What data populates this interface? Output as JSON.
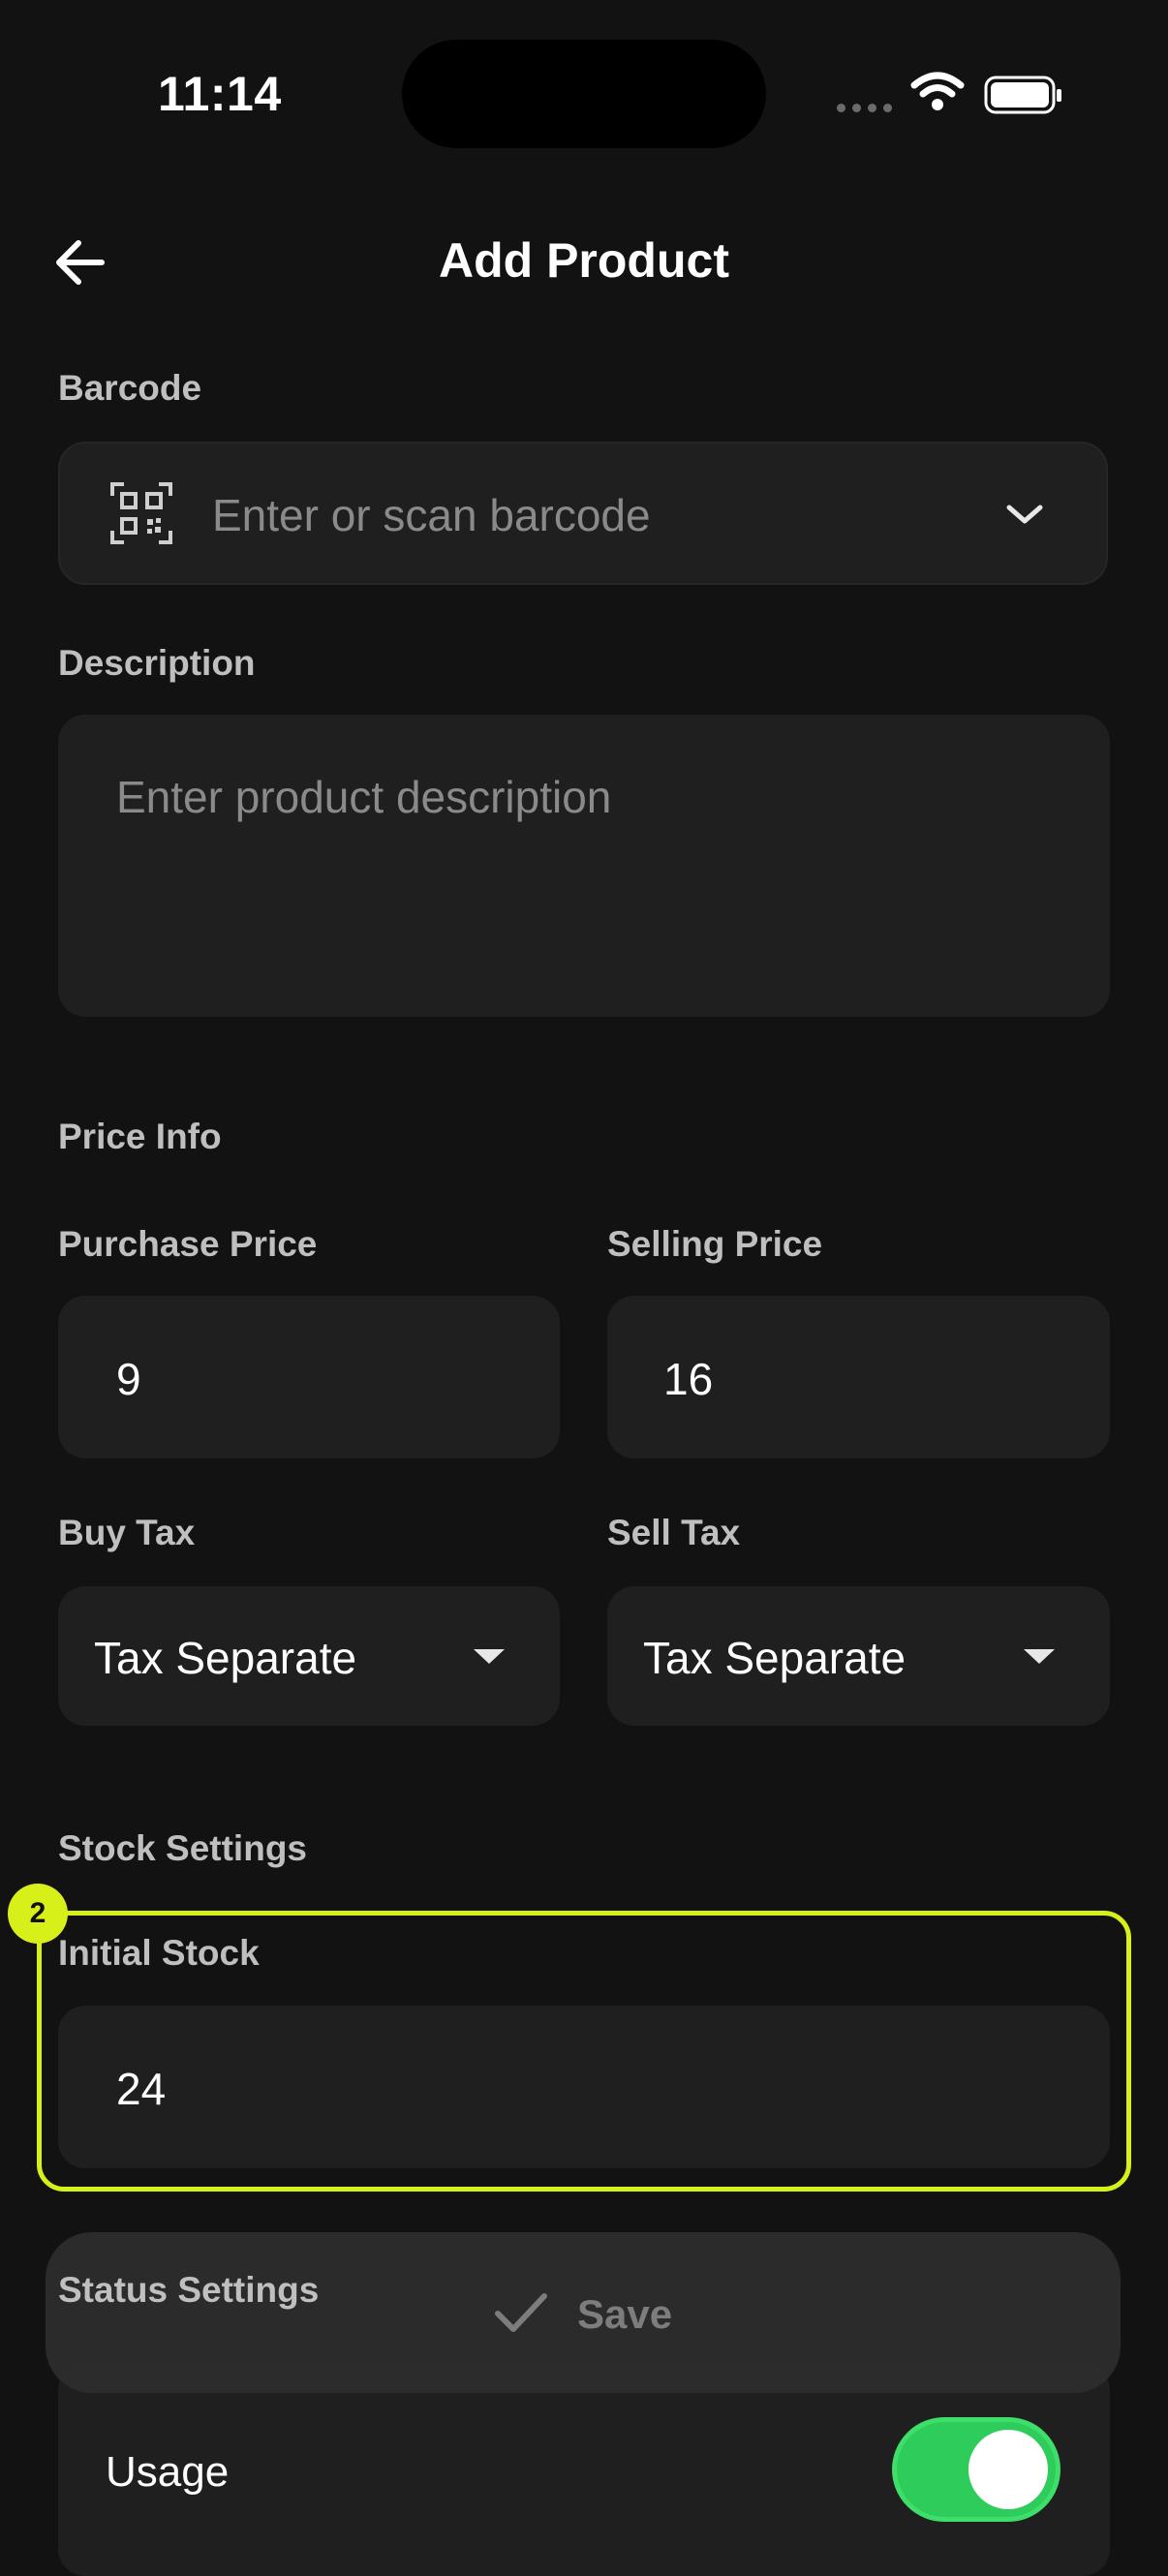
{
  "status_bar": {
    "time": "11:14"
  },
  "header": {
    "title": "Add Product"
  },
  "barcode": {
    "label": "Barcode",
    "placeholder": "Enter or scan barcode"
  },
  "description": {
    "label": "Description",
    "placeholder": "Enter product description"
  },
  "price_info": {
    "section_title": "Price Info",
    "purchase_price": {
      "label": "Purchase Price",
      "value": "9"
    },
    "selling_price": {
      "label": "Selling Price",
      "value": "16"
    },
    "buy_tax": {
      "label": "Buy Tax",
      "selected": "Tax Separate"
    },
    "sell_tax": {
      "label": "Sell Tax",
      "selected": "Tax Separate"
    }
  },
  "stock_settings": {
    "section_title": "Stock Settings",
    "initial_stock": {
      "label": "Initial Stock",
      "value": "24"
    },
    "highlight_badge": "2"
  },
  "status_settings": {
    "section_title": "Status Settings",
    "usage": {
      "label": "Usage",
      "enabled": true
    }
  },
  "save_button": {
    "label": "Save"
  },
  "colors": {
    "background": "#121212",
    "field": "#1f1f1f",
    "highlight": "#d8f01a",
    "toggle_on": "#2ecc5a"
  },
  "icons": [
    "back-arrow-icon",
    "qr-code-icon",
    "chevron-down-icon",
    "caret-down-icon",
    "checkmark-icon",
    "wifi-icon",
    "battery-icon"
  ]
}
